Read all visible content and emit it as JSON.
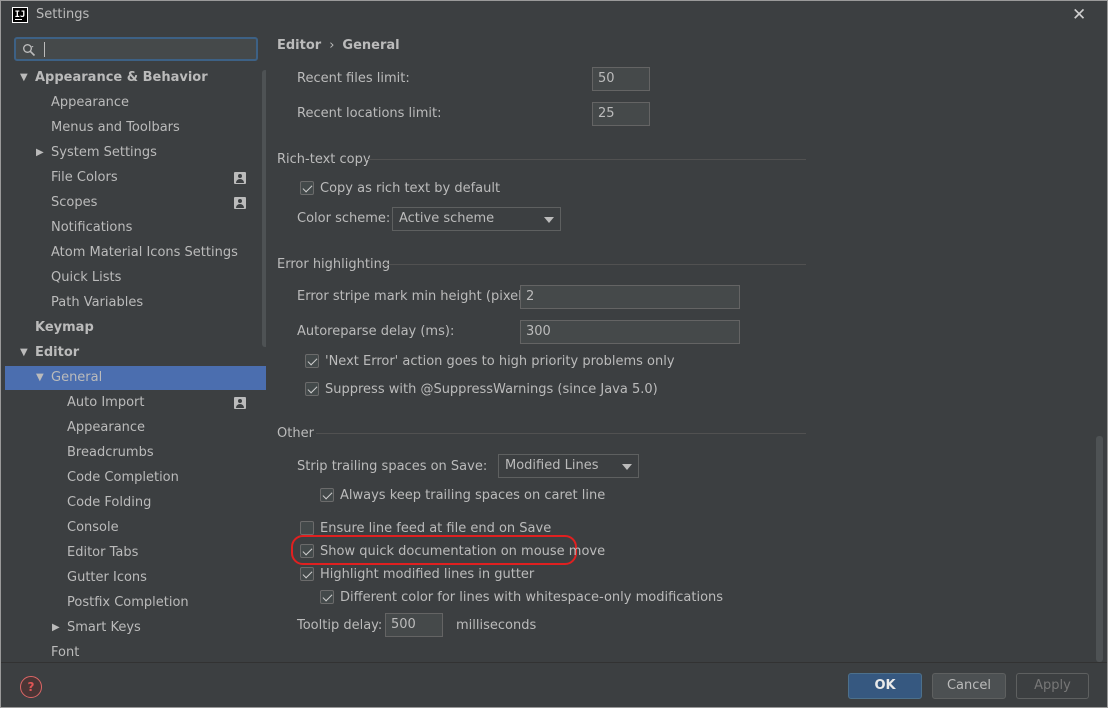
{
  "window": {
    "title": "Settings",
    "app_icon_text": "IJ",
    "close_glyph": "✕"
  },
  "search": {
    "value": "",
    "placeholder": ""
  },
  "tree": [
    {
      "label": "Appearance & Behavior",
      "bold": true,
      "expand": "open"
    },
    {
      "label": "Appearance"
    },
    {
      "label": "Menus and Toolbars"
    },
    {
      "label": "System Settings",
      "expand": "closed"
    },
    {
      "label": "File Colors",
      "badge": "user-icon"
    },
    {
      "label": "Scopes",
      "badge": "user-icon"
    },
    {
      "label": "Notifications"
    },
    {
      "label": "Atom Material Icons Settings"
    },
    {
      "label": "Quick Lists"
    },
    {
      "label": "Path Variables"
    },
    {
      "label": "Keymap",
      "bold": true
    },
    {
      "label": "Editor",
      "bold": true,
      "expand": "open"
    },
    {
      "label": "General",
      "expand": "open",
      "selected": true
    },
    {
      "label": "Auto Import",
      "badge": "user-icon"
    },
    {
      "label": "Appearance"
    },
    {
      "label": "Breadcrumbs"
    },
    {
      "label": "Code Completion"
    },
    {
      "label": "Code Folding"
    },
    {
      "label": "Console"
    },
    {
      "label": "Editor Tabs"
    },
    {
      "label": "Gutter Icons"
    },
    {
      "label": "Postfix Completion"
    },
    {
      "label": "Smart Keys",
      "expand": "closed"
    },
    {
      "label": "Font"
    }
  ],
  "breadcrumb": {
    "part1": "Editor",
    "separator": "›",
    "part2": "General"
  },
  "recent": {
    "files_label": "Recent files limit:",
    "files_value": "50",
    "locations_label": "Recent locations limit:",
    "locations_value": "25"
  },
  "rich_text": {
    "section": "Rich-text copy",
    "copy_label": "Copy as rich text by default",
    "copy_checked": true,
    "scheme_label": "Color scheme:",
    "scheme_value": "Active scheme"
  },
  "error_highlighting": {
    "section": "Error highlighting",
    "stripe_label": "Error stripe mark min height (pixels):",
    "stripe_value": "2",
    "reparse_label": "Autoreparse delay (ms):",
    "reparse_value": "300",
    "next_error_label": "'Next Error' action goes to high priority problems only",
    "next_error_checked": true,
    "suppress_label": "Suppress with @SuppressWarnings (since Java 5.0)",
    "suppress_checked": true
  },
  "other": {
    "section": "Other",
    "strip_label": "Strip trailing spaces on Save:",
    "strip_value": "Modified Lines",
    "keep_trailing_label": "Always keep trailing spaces on caret line",
    "keep_trailing_checked": true,
    "line_feed_label": "Ensure line feed at file end on Save",
    "line_feed_checked": false,
    "quick_doc_label": "Show quick documentation on mouse move",
    "quick_doc_checked": true,
    "highlight_modified_label": "Highlight modified lines in gutter",
    "highlight_modified_checked": true,
    "different_color_label": "Different color for lines with whitespace-only modifications",
    "different_color_checked": true,
    "tooltip_label": "Tooltip delay:",
    "tooltip_value": "500",
    "tooltip_unit": "milliseconds"
  },
  "footer": {
    "ok": "OK",
    "cancel": "Cancel",
    "apply": "Apply"
  },
  "colors": {
    "background": "#3c3f41",
    "selection": "#4b6eaf",
    "ok_button": "#365880",
    "highlight_ring": "#e02020"
  }
}
